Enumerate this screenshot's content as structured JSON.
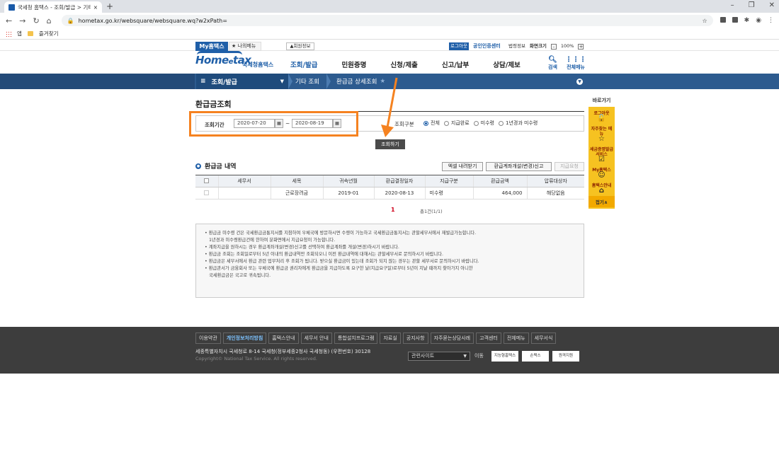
{
  "browser": {
    "tab_title": "국세청 홈택스 - 조회/발급 > 기타",
    "tab_close": "×",
    "new_tab": "+",
    "window_controls": [
      "–",
      "❐",
      "✕"
    ],
    "url": "hometax.go.kr/websquare/websquare.wq?w2xPath=",
    "bookmarks": [
      "앱",
      "즐겨찾기"
    ]
  },
  "util": {
    "my_hometax": "My홈택스",
    "my_menu": "★ 나의메뉴",
    "member_info": "▲회원정보",
    "logout": "로그아웃",
    "cert_center": "공인인증센터",
    "law_info": "법령정보",
    "screen_size": "화면크기",
    "zoom_minus": "–",
    "zoom": "100%",
    "zoom_plus": "+"
  },
  "logo": {
    "main": "Home",
    "e": "e",
    "tax": "tax",
    "org": "국세청홈택스"
  },
  "gnb": [
    "조회/발급",
    "민원증명",
    "신청/제출",
    "신고/납부",
    "상담/제보"
  ],
  "gnb_active": 0,
  "header_right": {
    "search": "검색",
    "allmenu": "전체메뉴"
  },
  "lnb": {
    "menu_icon": "≡",
    "section": "조회/발급",
    "dd": "▼",
    "crumb1": "기타 조회",
    "crumb2": "환급금 상세조회",
    "star": "★",
    "down": "▼"
  },
  "page": {
    "title": "환급금조회",
    "period_label": "조회기간",
    "date_from": "2020-07-20",
    "date_to": "2020-08-19",
    "tilde": "~",
    "cal": "▦",
    "type_label": "조회구분",
    "radios": [
      "전체",
      "지급완료",
      "미수령",
      "1년경과 미수령"
    ],
    "radio_selected": 0,
    "query_button": "조회하기"
  },
  "list": {
    "heading": "환급금 내역",
    "bullet": "●",
    "excel_button": "엑셀 내려받기",
    "account_button": "환급계좌개설(변경)신고",
    "pay_request_button": "지급요청",
    "columns": [
      "",
      "세무서",
      "세목",
      "귀속년월",
      "환급결정일자",
      "지급구분",
      "환급금액",
      "압류대상자"
    ],
    "rows": [
      [
        "",
        "",
        "근로장려금",
        "2019-01",
        "2020-08-13",
        "미수령",
        "464,000",
        "해당없음"
      ]
    ],
    "pager_mark": "1",
    "total": "총1건(1/1)"
  },
  "notes": [
    "환급금 미수령 건은 국세환급금통지서를 지참하여 우체국에 방문하시면 수령이 가능하고 국세환급금통지서는 관할세무서에서 재발급가능합니다.",
    "1년경과 미수령환급건에 한하여 분화면에서 지급요청이 가능합니다.",
    "계좌지급을 원하시는 경우 환급계좌개설(변경)신고를 선택하여 환급계좌를 개설(변경)하시기 바랍니다.",
    "환급금 조회는 조회일로부터 5년 이내의 환급내역만 조회되오니 이전 환급내역에 대해서는 관할세무서로 문의하시기 바랍니다.",
    "환급금은 세무서에서 환급 관련 업무처리 후 조회가 됩니다. 받으실 환급금이 있는데 조회가 되지 않는 경우는 관할 세무서로 문의하시기 바랍니다.",
    "환급관서가 금융회사 또는 우체국에 환급금 권리자에게 환급금을 지급하도록 요구한 날(지급요구일)로부터 5년이 지날 때까지 찾아가지 아니한",
    "국세환급금은 국고로 귀속됩니다."
  ],
  "quick": {
    "header": "바로가기",
    "items": [
      "로그아웃",
      "자주찾는 메뉴",
      "세금증명발급 서비스",
      "My홈택스",
      "홈택스안내"
    ],
    "icons": [
      "🔓",
      "☆",
      "☑",
      "☺",
      "⌂"
    ],
    "fold": "접기∧"
  },
  "footer": {
    "links": [
      "이용약관",
      "개인정보처리방침",
      "홈택스안내",
      "세무서 안내",
      "통합설치프로그램",
      "자료실",
      "공지사항",
      "자주묻는상담사례",
      "고객센터",
      "전체메뉴",
      "세무서식"
    ],
    "highlight": 1,
    "address": "세종특별자치시 국세청로 8-14 국세청(정부세종2청사 국세청동) (우편번호) 30128",
    "copyright": "Copyright© National Tax Service. All rights reserved.",
    "related_site": "관련사이트",
    "related_dd": "▼",
    "go": "이동",
    "logos": [
      "지능형홈택스",
      "손택스",
      "원격지원"
    ]
  },
  "colors": {
    "brand": "#1f5fa8",
    "highlight_box": "#f58220",
    "quick_bg": "#f6c221"
  }
}
